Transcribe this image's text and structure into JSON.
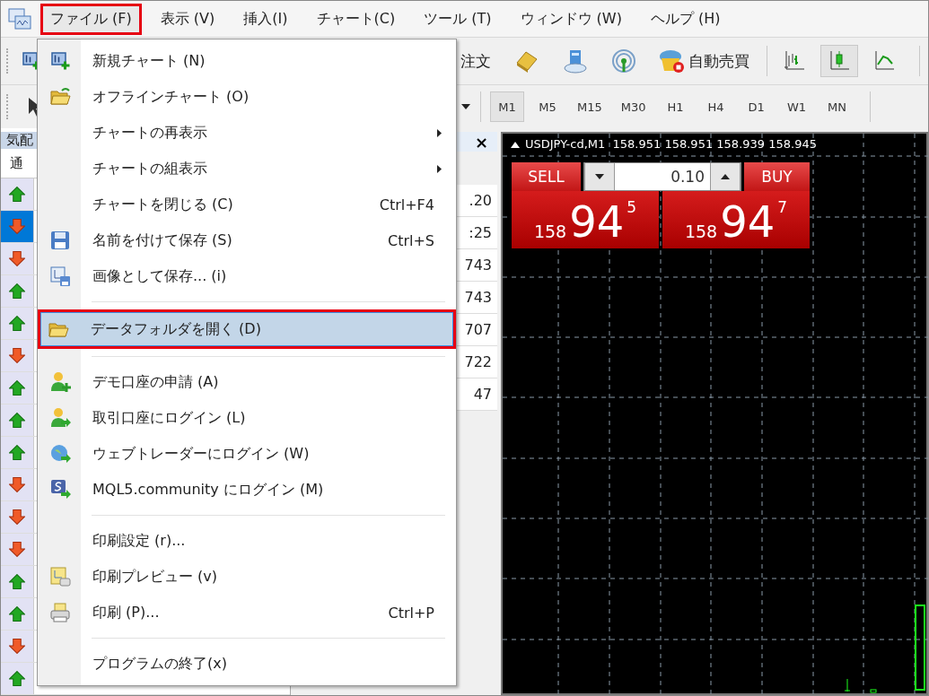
{
  "menubar": {
    "items": [
      {
        "label": "ファイル (F)",
        "selected": true,
        "marked": true
      },
      {
        "label": "表示 (V)",
        "selected": false,
        "marked": false
      },
      {
        "label": "挿入(I)",
        "selected": false,
        "marked": false
      },
      {
        "label": "チャート(C)",
        "selected": false,
        "marked": false
      },
      {
        "label": "ツール (T)",
        "selected": false,
        "marked": false
      },
      {
        "label": "ウィンドウ (W)",
        "selected": false,
        "marked": false
      },
      {
        "label": "ヘルプ (H)",
        "selected": false,
        "marked": false
      }
    ]
  },
  "file_menu": {
    "items": [
      {
        "kind": "item",
        "label": "新規チャート (N)",
        "submenu": false,
        "selected": false,
        "marked": false
      },
      {
        "kind": "item",
        "label": "オフラインチャート (O)",
        "submenu": false,
        "selected": false,
        "marked": false
      },
      {
        "kind": "item",
        "label": "チャートの再表示",
        "submenu": true,
        "selected": false,
        "marked": false
      },
      {
        "kind": "item",
        "label": "チャートの組表示",
        "submenu": true,
        "selected": false,
        "marked": false
      },
      {
        "kind": "item",
        "label": "チャートを閉じる (C)",
        "shortcut": "Ctrl+F4",
        "submenu": false,
        "selected": false,
        "marked": false
      },
      {
        "kind": "item",
        "label": "名前を付けて保存 (S)",
        "shortcut": "Ctrl+S",
        "submenu": false,
        "selected": false,
        "marked": false
      },
      {
        "kind": "item",
        "label": "画像として保存... (i)",
        "submenu": false,
        "selected": false,
        "marked": false
      },
      {
        "kind": "separator"
      },
      {
        "kind": "item",
        "label": "データフォルダを開く (D)",
        "submenu": false,
        "selected": true,
        "marked": true
      },
      {
        "kind": "separator"
      },
      {
        "kind": "item",
        "label": "デモ口座の申請 (A)",
        "submenu": false,
        "selected": false,
        "marked": false
      },
      {
        "kind": "item",
        "label": "取引口座にログイン (L)",
        "submenu": false,
        "selected": false,
        "marked": false
      },
      {
        "kind": "item",
        "label": "ウェブトレーダーにログイン (W)",
        "submenu": false,
        "selected": false,
        "marked": false
      },
      {
        "kind": "item",
        "label": "MQL5.community にログイン (M)",
        "submenu": false,
        "selected": false,
        "marked": false
      },
      {
        "kind": "separator"
      },
      {
        "kind": "item",
        "label": "印刷設定 (r)...",
        "submenu": false,
        "selected": false,
        "marked": false
      },
      {
        "kind": "item",
        "label": "印刷プレビュー (v)",
        "submenu": false,
        "selected": false,
        "marked": false
      },
      {
        "kind": "item",
        "label": "印刷 (P)...",
        "shortcut": "Ctrl+P",
        "submenu": false,
        "selected": false,
        "marked": false
      },
      {
        "kind": "separator"
      },
      {
        "kind": "item",
        "label": "プログラムの終了(x)",
        "submenu": false,
        "selected": false,
        "marked": false
      }
    ]
  },
  "toolbar": {
    "order_label": "注文",
    "auto_trading_label": "自動売買",
    "chart_types": [
      {
        "selected": false
      },
      {
        "selected": true
      },
      {
        "selected": false
      }
    ],
    "timeframes": [
      {
        "label": "M1",
        "selected": true
      },
      {
        "label": "M5",
        "selected": false
      },
      {
        "label": "M15",
        "selected": false
      },
      {
        "label": "M30",
        "selected": false
      },
      {
        "label": "H1",
        "selected": false
      },
      {
        "label": "H4",
        "selected": false
      },
      {
        "label": "D1",
        "selected": false
      },
      {
        "label": "W1",
        "selected": false
      },
      {
        "label": "MN",
        "selected": false
      }
    ]
  },
  "market_watch": {
    "title": "気配",
    "tab": "通",
    "rows": [
      {
        "rising": true,
        "selected": false
      },
      {
        "rising": false,
        "selected": true
      },
      {
        "rising": false,
        "selected": false
      },
      {
        "rising": true,
        "selected": false
      },
      {
        "rising": true,
        "selected": false
      },
      {
        "rising": false,
        "selected": false
      },
      {
        "rising": true,
        "selected": false
      },
      {
        "rising": true,
        "selected": false
      },
      {
        "rising": true,
        "selected": false
      },
      {
        "rising": false,
        "selected": false
      },
      {
        "rising": false,
        "selected": false
      },
      {
        "rising": false,
        "selected": false
      },
      {
        "rising": true,
        "selected": false
      },
      {
        "rising": true,
        "selected": false
      },
      {
        "rising": false,
        "selected": false
      },
      {
        "rising": true,
        "selected": false
      }
    ]
  },
  "data_panel": {
    "close": "×",
    "values": [
      ".20",
      ":25",
      "743",
      "743",
      "707",
      "722",
      "47"
    ]
  },
  "chart": {
    "header": "USDJPY-cd,M1  158.951 158.951 158.939 158.945",
    "trade": {
      "sell_label": "SELL",
      "buy_label": "BUY",
      "lot": "0.10",
      "bid": {
        "big": "158",
        "main": "94",
        "small": "5"
      },
      "ask": {
        "big": "158",
        "main": "94",
        "small": "7"
      }
    }
  }
}
